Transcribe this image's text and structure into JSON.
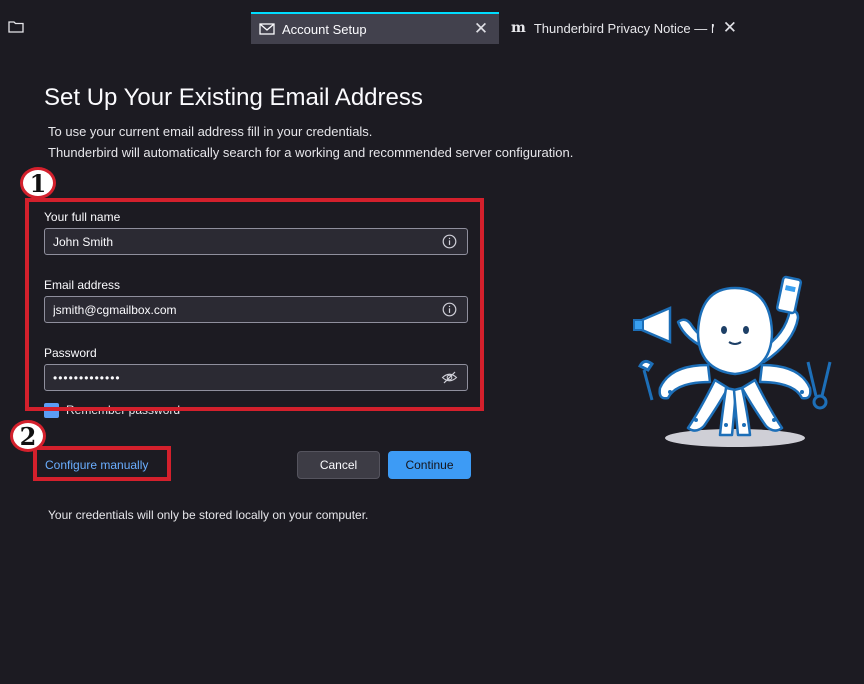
{
  "tabs": [
    {
      "label": "Account Setup",
      "icon": "mail-icon",
      "active": true,
      "close": "✕"
    },
    {
      "label": "Thunderbird Privacy Notice — Mozilla",
      "icon": "mozilla-logo-icon",
      "logo_text": "m",
      "close": "✕"
    }
  ],
  "content": {
    "title": "Set Up Your Existing Email Address",
    "intro_line_1": "To use your current email address fill in your credentials.",
    "intro_line_2": "Thunderbird will automatically search for a working and recommended server configuration."
  },
  "form": {
    "name_label": "Your full name",
    "name_value": "John Smith",
    "email_label": "Email address",
    "email_value": "jsmith@cgmailbox.com",
    "password_label": "Password",
    "password_value": "•••••••••••••",
    "remember_label": "Remember password",
    "remember_checked": true
  },
  "actions": {
    "configure_manually": "Configure manually",
    "cancel": "Cancel",
    "continue": "Continue"
  },
  "footer": {
    "note": "Your credentials will only be stored locally on your computer."
  },
  "annotations": {
    "step_1": "1",
    "step_2": "2",
    "color": "#d3202c"
  },
  "colors": {
    "background": "#1c1b22",
    "accent": "#3d9bf5",
    "link": "#6aaeff",
    "field_bg": "#2b2a33"
  }
}
